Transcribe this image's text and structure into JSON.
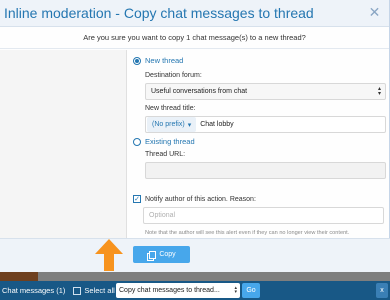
{
  "modal": {
    "title": "Inline moderation - Copy chat messages to thread",
    "close_icon": "close-icon",
    "confirm_text": "Are you sure you want to copy 1 chat message(s) to a new thread?",
    "new_thread_label": "New thread",
    "destination_forum_label": "Destination forum:",
    "destination_forum_value": "Useful conversations from chat",
    "new_thread_title_label": "New thread title:",
    "prefix_value": "(No prefix)",
    "thread_title_value": "Chat lobby",
    "existing_thread_label": "Existing thread",
    "thread_url_label": "Thread URL:",
    "notify_label": "Notify author of this action. Reason:",
    "reason_placeholder": "Optional",
    "note_text": "Note that the author will see this alert even if they can no longer view their content.",
    "copy_button_label": "Copy"
  },
  "bottom_bar": {
    "title": "Chat messages (1)",
    "select_all_label": "Select all",
    "action_value": "Copy chat messages to thread...",
    "go_label": "Go",
    "close_label": "x"
  },
  "colors": {
    "accent": "#2577b1",
    "button": "#47a7eb",
    "bar": "#185886",
    "arrow": "#f7931e"
  }
}
